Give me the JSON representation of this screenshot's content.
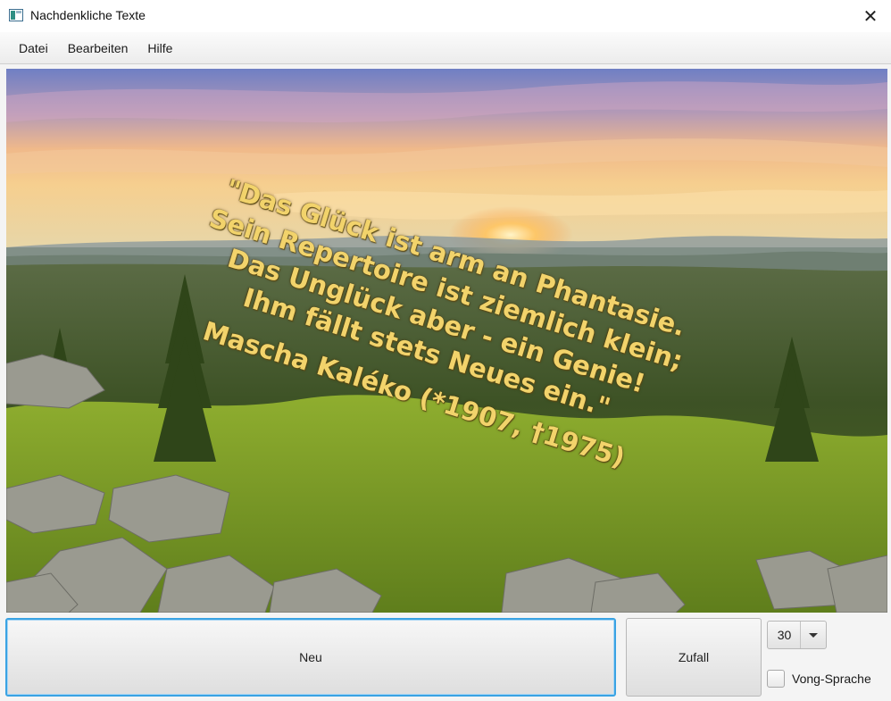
{
  "window": {
    "title": "Nachdenkliche Texte",
    "close_glyph": "✕"
  },
  "menu": {
    "items": [
      "Datei",
      "Bearbeiten",
      "Hilfe"
    ]
  },
  "quote": {
    "lines": [
      "\"Das Glück ist arm an Phantasie.",
      "Sein Repertoire ist ziemlich klein;",
      "Das Unglück aber - ein Genie!",
      "Ihm fällt stets Neues ein.\""
    ],
    "author": "Mascha Kaléko (*1907, †1975)",
    "color": "#f2d36b"
  },
  "controls": {
    "new_label": "Neu",
    "random_label": "Zufall",
    "size_select": {
      "value": "30"
    },
    "vong_checkbox": {
      "label": "Vong-Sprache",
      "checked": false
    }
  },
  "icons": {
    "app": "app-window-icon",
    "close": "close-icon",
    "dropdown": "chevron-down-icon"
  }
}
